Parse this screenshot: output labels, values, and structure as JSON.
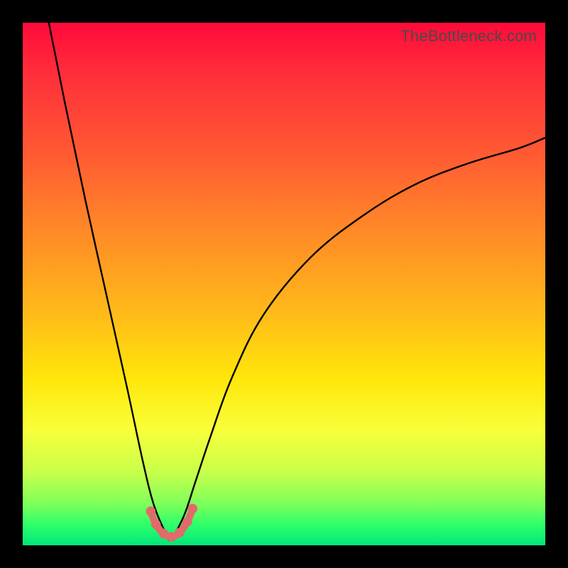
{
  "watermark": "TheBottleneck.com",
  "colors": {
    "background_frame": "#000000",
    "gradient_top": "#ff0a3a",
    "gradient_bottom": "#00e879",
    "curve_stroke": "#000000",
    "marker_stroke": "#e26a6a",
    "marker_fill": "#e26a6a"
  },
  "chart_data": {
    "type": "line",
    "title": "",
    "xlabel": "",
    "ylabel": "",
    "xlim": [
      0,
      100
    ],
    "ylim": [
      0,
      100
    ],
    "grid": false,
    "legend": false,
    "description": "Bottleneck curve: deep narrow trough. Y ~100 (severe) at x≈5, drops to ~0 at x≈28, rises back toward ~78 at x=100. Lower values (near 0) are optimal (green).",
    "series": [
      {
        "name": "bottleneck-curve",
        "x": [
          5,
          8,
          12,
          16,
          20,
          23,
          25,
          27,
          28,
          29,
          31,
          33,
          36,
          40,
          46,
          55,
          65,
          75,
          85,
          95,
          100
        ],
        "y": [
          100,
          85,
          66,
          48,
          30,
          16,
          8,
          3,
          1,
          2,
          6,
          12,
          21,
          32,
          44,
          55,
          63,
          69,
          73,
          76,
          78
        ]
      }
    ],
    "markers": {
      "description": "Small salmon U-shaped beaded marker at the curve minimum",
      "points": [
        {
          "x": 24.5,
          "y": 6.5
        },
        {
          "x": 25.5,
          "y": 4.0
        },
        {
          "x": 27.0,
          "y": 2.2
        },
        {
          "x": 28.5,
          "y": 1.6
        },
        {
          "x": 30.0,
          "y": 2.4
        },
        {
          "x": 31.5,
          "y": 4.5
        },
        {
          "x": 32.5,
          "y": 7.0
        }
      ]
    }
  }
}
